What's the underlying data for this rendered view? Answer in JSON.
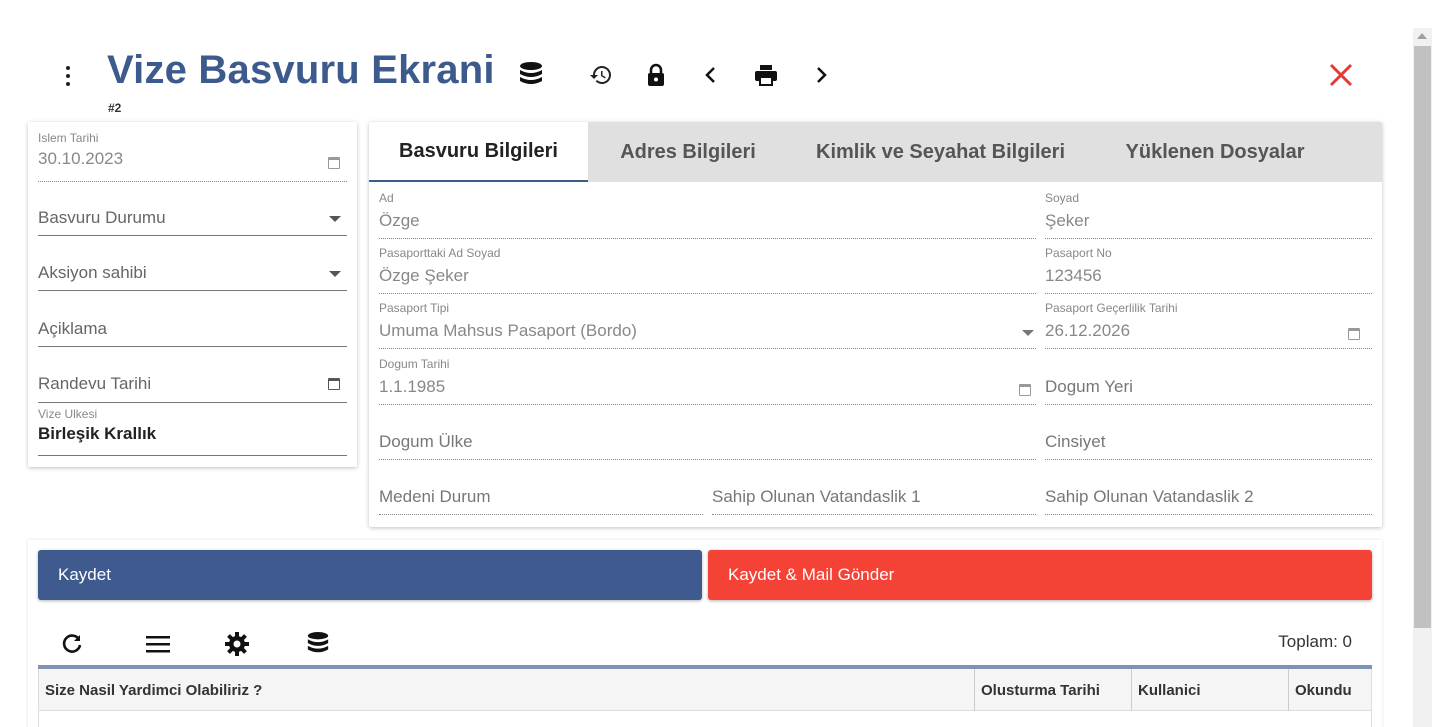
{
  "header": {
    "title": "Vize Basvuru Ekrani",
    "record_id": "#2",
    "icons": [
      "more-vert-icon",
      "database-icon",
      "history-icon",
      "lock-icon",
      "chevron-left-icon",
      "print-icon",
      "chevron-right-icon",
      "close-icon"
    ],
    "close_color": "#e53935",
    "title_color": "#3d5a8c"
  },
  "left_form": {
    "islem_tarihi": {
      "label": "Islem Tarihi",
      "value": "30.10.2023"
    },
    "basvuru_durumu": {
      "placeholder": "Basvuru Durumu"
    },
    "aksiyon_sahibi": {
      "placeholder": "Aksiyon sahibi"
    },
    "aciklama": {
      "placeholder": "Açiklama"
    },
    "randevu_tarihi": {
      "placeholder": "Randevu Tarihi"
    },
    "vize_ulkesi": {
      "label": "Vize Ulkesi",
      "value": "Birleşik Krallık"
    }
  },
  "tabs": [
    {
      "label": "Basvuru Bilgileri",
      "active": true
    },
    {
      "label": "Adres Bilgileri",
      "active": false
    },
    {
      "label": "Kimlik ve Seyahat Bilgileri",
      "active": false
    },
    {
      "label": "Yüklenen Dosyalar",
      "active": false
    }
  ],
  "basvuru": {
    "ad": {
      "label": "Ad",
      "value": "Özge"
    },
    "soyad": {
      "label": "Soyad",
      "value": "Şeker"
    },
    "pasaport_ad_soyad": {
      "label": "Pasaporttaki Ad Soyad",
      "value": "Özge Şeker"
    },
    "pasaport_no": {
      "label": "Pasaport No",
      "value": "123456"
    },
    "pasaport_tipi": {
      "label": "Pasaport Tipi",
      "value": "Umuma Mahsus Pasaport (Bordo)"
    },
    "pasaport_gecerlilik": {
      "label": "Pasaport Geçerlilik Tarihi",
      "value": "26.12.2026"
    },
    "dogum_tarihi": {
      "label": "Dogum Tarihi",
      "value": "1.1.1985"
    },
    "dogum_yeri": {
      "placeholder": "Dogum Yeri"
    },
    "dogum_ulke": {
      "placeholder": "Dogum Ülke"
    },
    "cinsiyet": {
      "placeholder": "Cinsiyet"
    },
    "medeni_durum": {
      "placeholder": "Medeni Durum"
    },
    "vatandaslik1": {
      "placeholder": "Sahip Olunan Vatandaslik 1"
    },
    "vatandaslik2": {
      "placeholder": "Sahip Olunan Vatandaslik 2"
    }
  },
  "actions": {
    "save_label": "Kaydet",
    "save_mail_label": "Kaydet & Mail Gönder",
    "save_color": "#3e5a8e",
    "save_mail_color": "#f44336"
  },
  "grid": {
    "toolbar_icons": [
      "refresh-icon",
      "menu-icon",
      "settings-icon",
      "database-icon"
    ],
    "total_label": "Toplam: 0",
    "columns": [
      "Size Nasil Yardimci Olabiliriz ?",
      "Olusturma Tarihi",
      "Kullanici",
      "Okundu"
    ]
  }
}
